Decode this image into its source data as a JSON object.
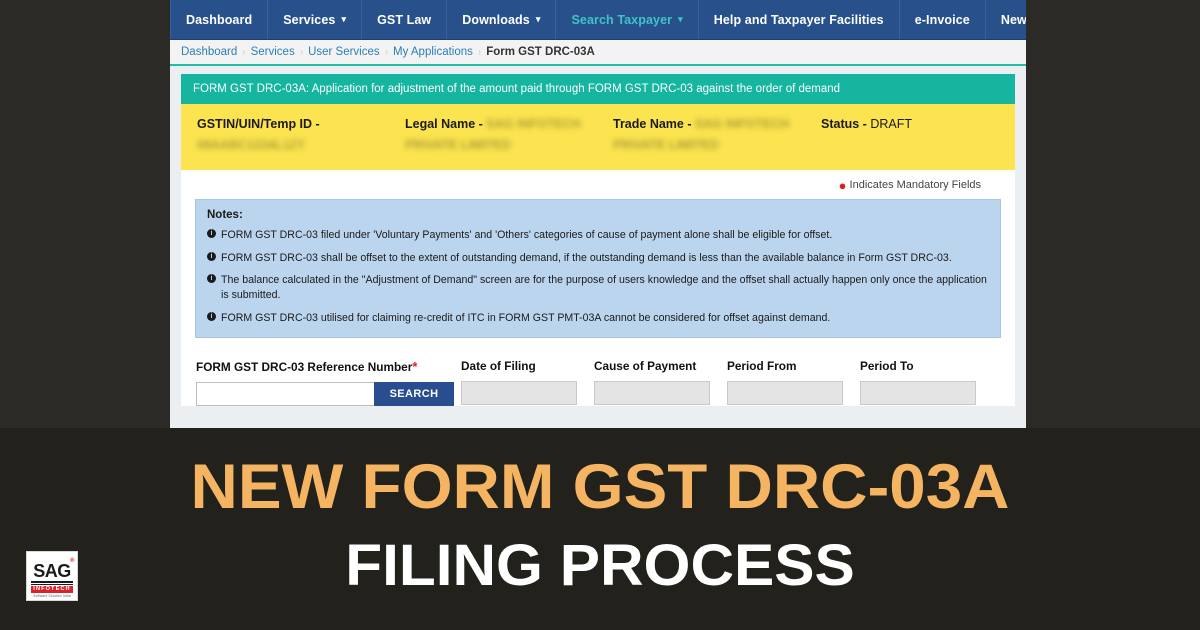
{
  "colors": {
    "nav_bg": "#28518c",
    "nav_active": "#3fc3c7",
    "teal_banner": "#15b5a0",
    "yellow_panel": "#fbe44f",
    "notes_bg": "#bcd5ee",
    "search_button": "#2a4d8f",
    "banner_bg": "#22211c",
    "banner_title_accent": "#f5b462",
    "required_star": "#e02020"
  },
  "nav": {
    "items": [
      {
        "label": "Dashboard",
        "has_caret": false,
        "active": false
      },
      {
        "label": "Services",
        "has_caret": true,
        "active": false
      },
      {
        "label": "GST Law",
        "has_caret": false,
        "active": false
      },
      {
        "label": "Downloads",
        "has_caret": true,
        "active": false
      },
      {
        "label": "Search Taxpayer",
        "has_caret": true,
        "active": true
      },
      {
        "label": "Help and Taxpayer Facilities",
        "has_caret": false,
        "active": false
      },
      {
        "label": "e-Invoice",
        "has_caret": false,
        "active": false
      },
      {
        "label": "News and Updates",
        "has_caret": false,
        "active": false
      }
    ],
    "caret_glyph": "▾"
  },
  "breadcrumb": {
    "separator": "›",
    "items": [
      "Dashboard",
      "Services",
      "User Services",
      "My Applications",
      "Form GST DRC-03A"
    ]
  },
  "teal_banner": {
    "text": "FORM GST DRC-03A: Application for adjustment of the amount paid through FORM GST DRC-03 against the order of demand"
  },
  "taxpayer_info": {
    "gstin_label": "GSTIN/UIN/Temp ID -",
    "gstin_value": "08AABC1234L1ZY",
    "legal_name_label": "Legal Name -",
    "legal_name_value_line1": "SAG INFOTECH",
    "legal_name_value_line2": "PRIVATE LIMITED",
    "trade_name_label": "Trade Name -",
    "trade_name_value_line1": "SAG INFOTECH",
    "trade_name_value_line2": "PRIVATE LIMITED",
    "status_label": "Status -",
    "status_value": "DRAFT"
  },
  "mandatory_note": {
    "star": "●",
    "text": "Indicates Mandatory Fields"
  },
  "notes": {
    "title": "Notes:",
    "icon_glyph": "i",
    "items": [
      "FORM GST DRC-03 filed under 'Voluntary Payments' and 'Others' categories of cause of payment alone shall be eligible for offset.",
      "FORM GST DRC-03 shall be offset to the extent of outstanding demand, if the outstanding demand is less than the available balance in Form GST DRC-03.",
      "The balance calculated in the \"Adjustment of Demand\" screen are for the purpose of users knowledge and the offset shall actually happen only once the application is submitted.",
      "FORM GST DRC-03 utilised for claiming re-credit of ITC in FORM GST PMT-03A cannot be considered for offset against demand."
    ]
  },
  "form": {
    "reference_number": {
      "label": "FORM GST DRC-03 Reference Number",
      "required_marker": "*",
      "value": "",
      "placeholder": ""
    },
    "search_button_label": "SEARCH",
    "date_of_filing": {
      "label": "Date of Filing",
      "value": ""
    },
    "cause_of_payment": {
      "label": "Cause of Payment",
      "value": ""
    },
    "period_from": {
      "label": "Period From",
      "value": ""
    },
    "period_to": {
      "label": "Period To",
      "value": ""
    }
  },
  "banner": {
    "title_line1": "NEW FORM GST DRC-03A",
    "title_line2": "FILING PROCESS"
  },
  "logo": {
    "name": "SAG",
    "registered_mark": "®",
    "subtitle": "INFOTECH",
    "tagline": "Software Solution India"
  }
}
